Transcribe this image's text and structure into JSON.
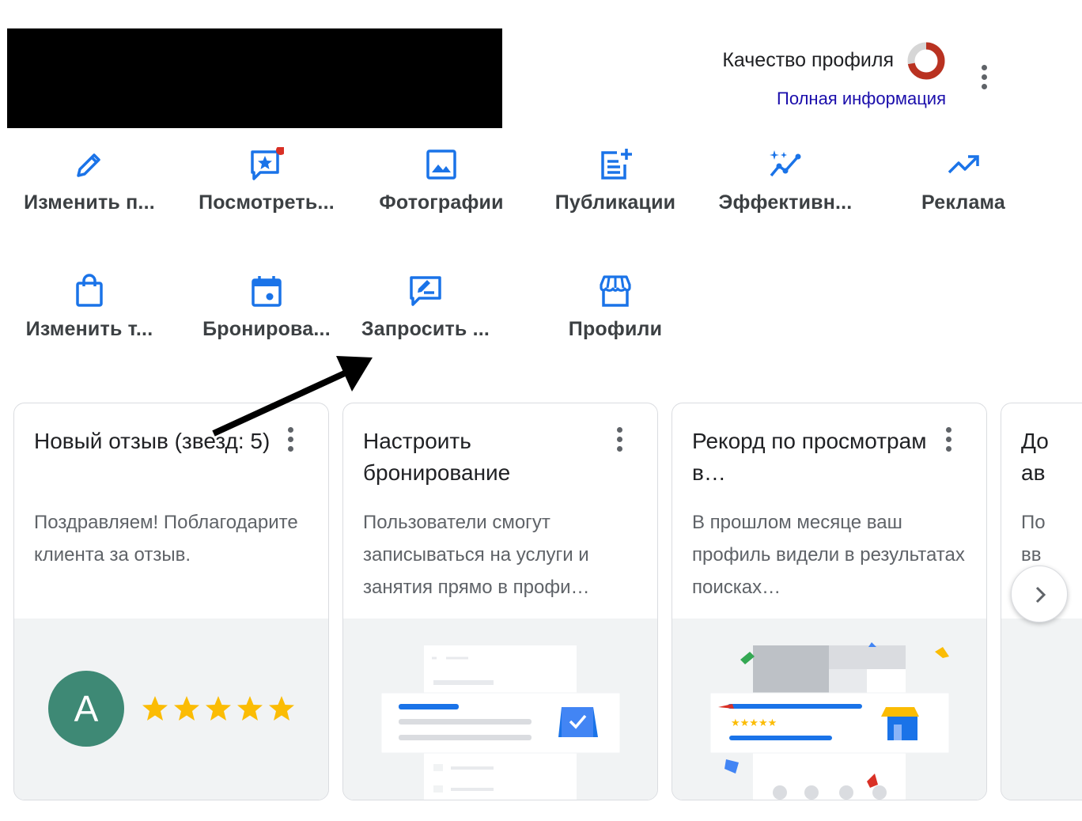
{
  "header": {
    "profile_quality_label": "Качество профиля",
    "full_info_link": "Полная информация",
    "quality_ring_colors": {
      "filled": "#b93221",
      "empty": "#d6d6d6"
    }
  },
  "actions_row1": [
    {
      "label": "Изменить п...",
      "icon": "pencil-icon"
    },
    {
      "label": "Посмотреть...",
      "icon": "review-star-icon"
    },
    {
      "label": "Фотографии",
      "icon": "photo-icon"
    },
    {
      "label": "Публикации",
      "icon": "post-add-icon"
    },
    {
      "label": "Эффективн...",
      "icon": "sparkle-chart-icon"
    },
    {
      "label": "Реклама",
      "icon": "trending-up-icon"
    }
  ],
  "actions_row2": [
    {
      "label": "Изменить т...",
      "icon": "shopping-bag-icon"
    },
    {
      "label": "Бронирова...",
      "icon": "calendar-icon"
    },
    {
      "label": "Запросить ...",
      "icon": "rate-review-icon"
    },
    {
      "label": "Профили",
      "icon": "storefront-icon"
    }
  ],
  "cards": [
    {
      "title": "Новый отзыв (звезд: 5)",
      "body": "Поздравляем! Поблагодарите клиента за отзыв.",
      "avatar_letter": "A",
      "avatar_color": "#3e8975",
      "stars": 5
    },
    {
      "title": "Настроить бронирование",
      "body": "Пользователи смогут записываться на услуги и занятия прямо в профи…"
    },
    {
      "title": "Рекорд по просмотрам в…",
      "body": "В прошлом месяце ваш профиль видели в результатах поисках…"
    },
    {
      "title": "До ав",
      "body": "По вв ал"
    }
  ],
  "colors": {
    "accent": "#1a73e8",
    "badge": "#d93025",
    "star": "#fbbc04"
  }
}
